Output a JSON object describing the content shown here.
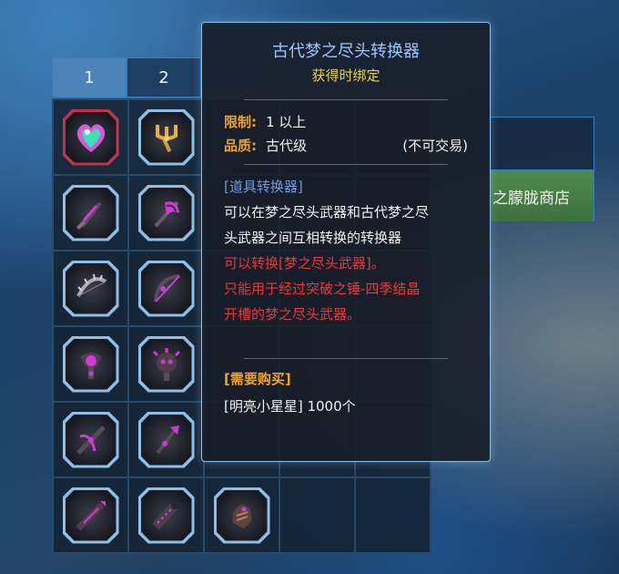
{
  "inventory": {
    "tabs": [
      {
        "label": "1",
        "active": true
      },
      {
        "label": "2",
        "active": false
      }
    ],
    "items": [
      {
        "icon": "heart-gem-icon",
        "color": "#e256d8",
        "frame": "red"
      },
      {
        "icon": "golden-trident-icon",
        "color": "#e6b23a",
        "frame": "blue"
      },
      {
        "icon": "purple-sword-icon",
        "color": "#d23ad8",
        "frame": "blue"
      },
      {
        "icon": "purple-axe-icon",
        "color": "#d23ad8",
        "frame": "blue"
      },
      {
        "icon": "spiked-bow-icon",
        "color": "#b0a8b8",
        "frame": "blue"
      },
      {
        "icon": "purple-bow-icon",
        "color": "#d23ad8",
        "frame": "blue"
      },
      {
        "icon": "purple-orb-staff-icon",
        "color": "#d23ad8",
        "frame": "blue"
      },
      {
        "icon": "purple-skull-mace-icon",
        "color": "#d23ad8",
        "frame": "blue"
      },
      {
        "icon": "purple-crossbow-icon",
        "color": "#d23ad8",
        "frame": "blue"
      },
      {
        "icon": "purple-scepter-icon",
        "color": "#d23ad8",
        "frame": "blue"
      },
      {
        "icon": "purple-lance-icon",
        "color": "#d23ad8",
        "frame": "blue"
      },
      {
        "icon": "purple-cannon-icon",
        "color": "#d23ad8",
        "frame": "blue"
      },
      {
        "icon": "purple-gauntlet-icon",
        "color": "#c27a5a",
        "frame": "blue"
      }
    ]
  },
  "shop": {
    "label": "之朦胧商店"
  },
  "tooltip": {
    "title": "古代梦之尽头转换器",
    "bind": "获得时绑定",
    "limit_label": "限制:",
    "limit_value": "1 以上",
    "grade_label": "品质:",
    "grade_value": "古代级",
    "trade": "(不可交易)",
    "category": "[道具转换器]",
    "desc_line1": "可以在梦之尽头武器和古代梦之尽",
    "desc_line2": "头武器之间互相转换的转换器",
    "red_line1": "可以转换[梦之尽头武器]。",
    "red_line2": "只能用于经过突破之锤-四季结晶",
    "red_line3": "开槽的梦之尽头武器。",
    "purchase_label": "[需要购买]",
    "purchase_value": "[明亮小星星] 1000个"
  }
}
